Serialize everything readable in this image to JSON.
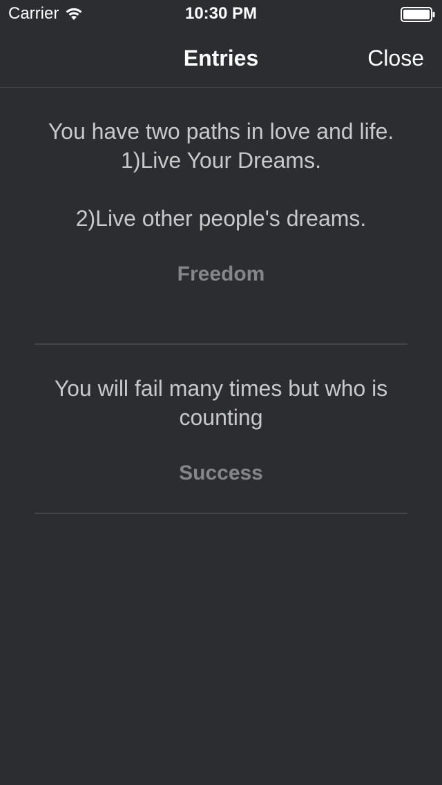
{
  "status_bar": {
    "carrier": "Carrier",
    "time": "10:30 PM",
    "wifi_icon": "wifi-icon",
    "battery_icon": "battery-icon"
  },
  "nav": {
    "title": "Entries",
    "close_label": "Close"
  },
  "entries": [
    {
      "quote": "You have two paths in love and life.\n1)Live Your Dreams.\n\n2)Live other people's dreams.",
      "category": "Freedom"
    },
    {
      "quote": "You will fail many times but who is counting",
      "category": "Success"
    }
  ],
  "colors": {
    "background": "#2c2d31",
    "quote_text": "#c9c9cb",
    "category_text": "#85868a",
    "separator": "#444549"
  }
}
